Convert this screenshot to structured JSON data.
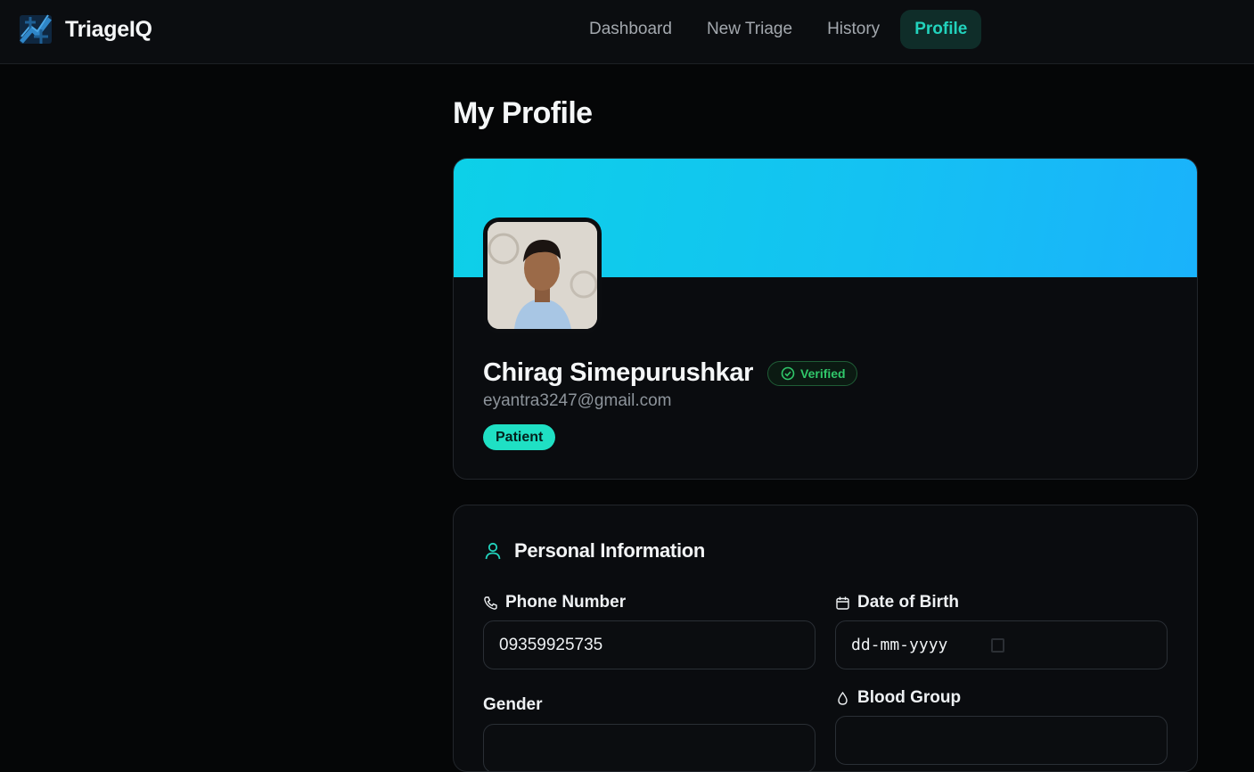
{
  "app": {
    "name": "TriageIQ"
  },
  "nav": {
    "items": [
      {
        "label": "Dashboard",
        "active": false
      },
      {
        "label": "New Triage",
        "active": false
      },
      {
        "label": "History",
        "active": false
      },
      {
        "label": "Profile",
        "active": true
      }
    ]
  },
  "page": {
    "title": "My Profile"
  },
  "profile": {
    "name": "Chirag Simepurushkar",
    "verified_label": "Verified",
    "email": "eyantra3247@gmail.com",
    "role": "Patient"
  },
  "personal": {
    "title": "Personal Information",
    "phone": {
      "label": "Phone Number",
      "value": "09359925735"
    },
    "dob": {
      "label": "Date of Birth",
      "value": "dd-mm-yyyy"
    },
    "gender": {
      "label": "Gender"
    },
    "blood_group": {
      "label": "Blood Group"
    }
  },
  "colors": {
    "accent": "#22d3bd",
    "banner_start": "#0dd0e8",
    "banner_end": "#1ab2fb",
    "verified": "#30c76a",
    "background": "#050607"
  }
}
